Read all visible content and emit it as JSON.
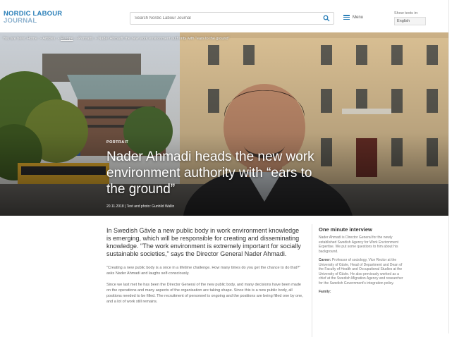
{
  "header": {
    "logo_line1": "NORDIC LABOUR",
    "logo_line2": "JOURNAL",
    "search_placeholder": "Search Nordic Labour Journal",
    "menu_label": "Menu",
    "lang_label": "Show texts in:",
    "lang_value": "English",
    "colors": {
      "brand": "#2a7fb8",
      "brand_light": "#8fb3cf"
    }
  },
  "breadcrumb": [
    "You are here: Home",
    "Articles",
    "Europe",
    "Portraits",
    "Nader Ahmadi: the new work environment authority with \"ears to the ground\""
  ],
  "article": {
    "section": "PORTRAIT",
    "title": "Nader Ahmadi heads the new work environment authority with “ears to the ground”",
    "meta": "20.11.2018  |  Text and photo: Gunhild Wallin",
    "lead": "In Swedish Gävle a new public body in work environment knowledge is emerging, which will be responsible for creating and disseminating knowledge. \"The work environment is extremely important for socially sustainable societies,\" says the Director General Nader Ahmadi.",
    "para1": "\"Creating a new public body is a once in a lifetime challenge. How many times do you get the chance to do that?\" asks Nader Ahmadi and laughs self-consciously.",
    "para2": "Since we last met he has been the Director General of the new public body, and many decisions have been made on the operations and many aspects of the organisation are taking shape. Since this is a new public body, all positions needed to be filled. The recruitment of personnel is ongoing and the positions are being filled one by one, and a lot of work still remains."
  },
  "aside": {
    "title": "One minute interview",
    "intro": "Nader Ahmadi is Director General for the newly established Swedish Agency for Work Environment Expertise. We put some questions to him about his background.",
    "career_label": "Career:",
    "career": "Professor of sociology, Vice Rector at the University of Gävle, Head of Department and Dean of the Faculty of Health and Occupational Studies at the University of Gävle. He also previously worked as a chief at the Swedish Migration Agency and researcher for the Swedish Government's integration policy.",
    "family_label": "Family:"
  }
}
